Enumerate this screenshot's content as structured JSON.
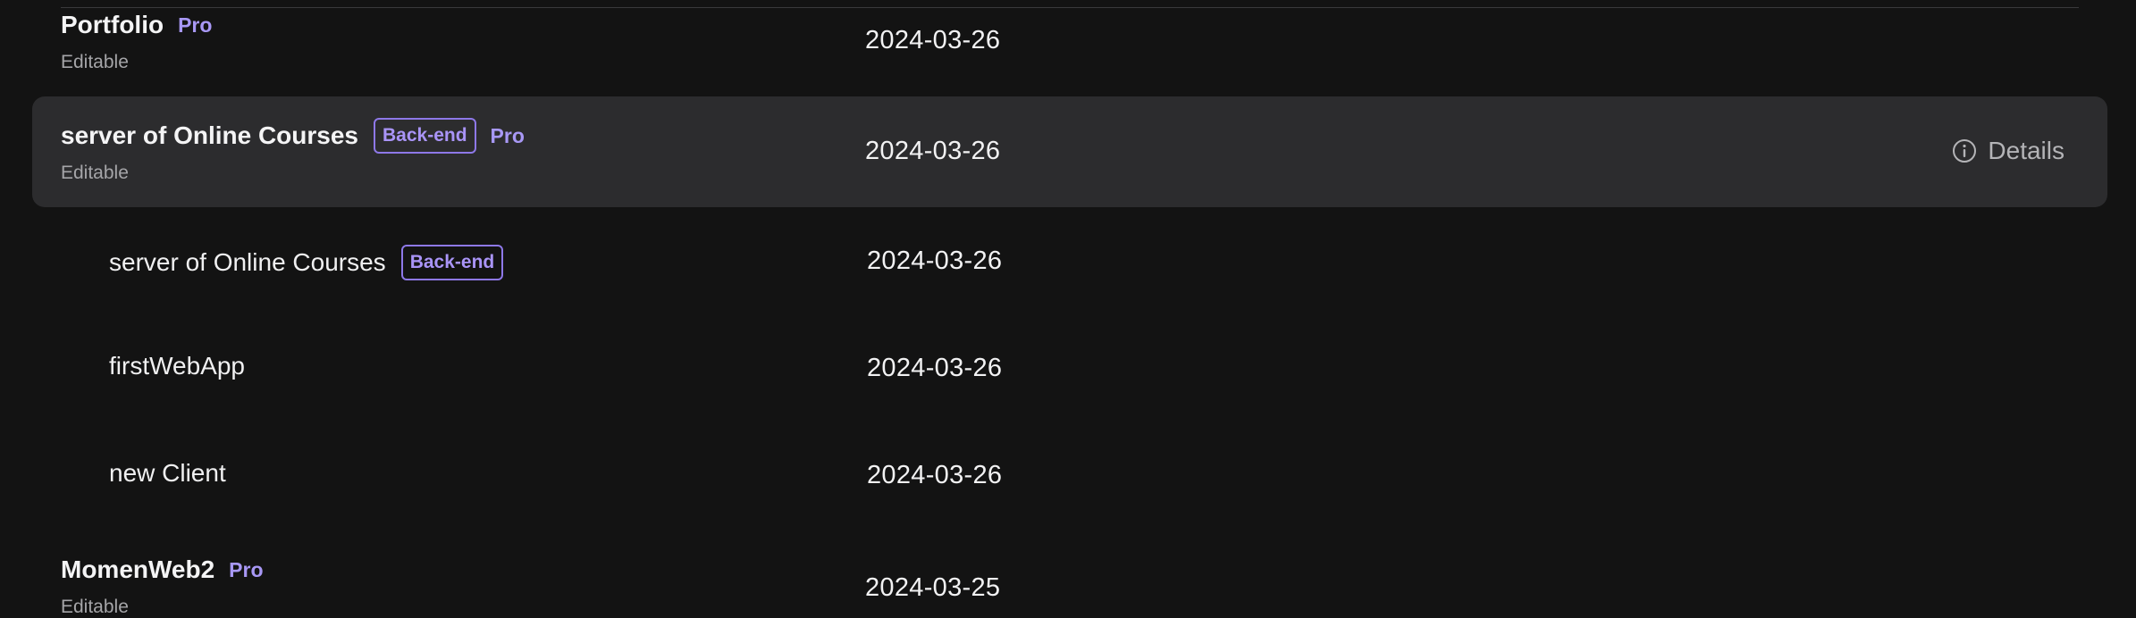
{
  "rows": [
    {
      "title": "Portfolio",
      "badge": "Pro",
      "subtitle": "Editable",
      "date": "2024-03-26"
    },
    {
      "title": "server of Online Courses",
      "tag": "Back-end",
      "badge": "Pro",
      "subtitle": "Editable",
      "date": "2024-03-26",
      "action_label": "Details",
      "action_icon": "info-circle-icon",
      "highlighted": true
    },
    {
      "title": "server of Online Courses",
      "tag": "Back-end",
      "date": "2024-03-26",
      "nested": true
    },
    {
      "title": "firstWebApp",
      "date": "2024-03-26",
      "nested": true
    },
    {
      "title": "new Client",
      "date": "2024-03-26",
      "nested": true
    },
    {
      "title": "MomenWeb2",
      "badge": "Pro",
      "subtitle": "Editable",
      "date": "2024-03-25"
    }
  ],
  "colors": {
    "background": "#131313",
    "highlight_row": "#2c2c2e",
    "accent": "#a898f5",
    "tag_border": "#8e78e8"
  }
}
